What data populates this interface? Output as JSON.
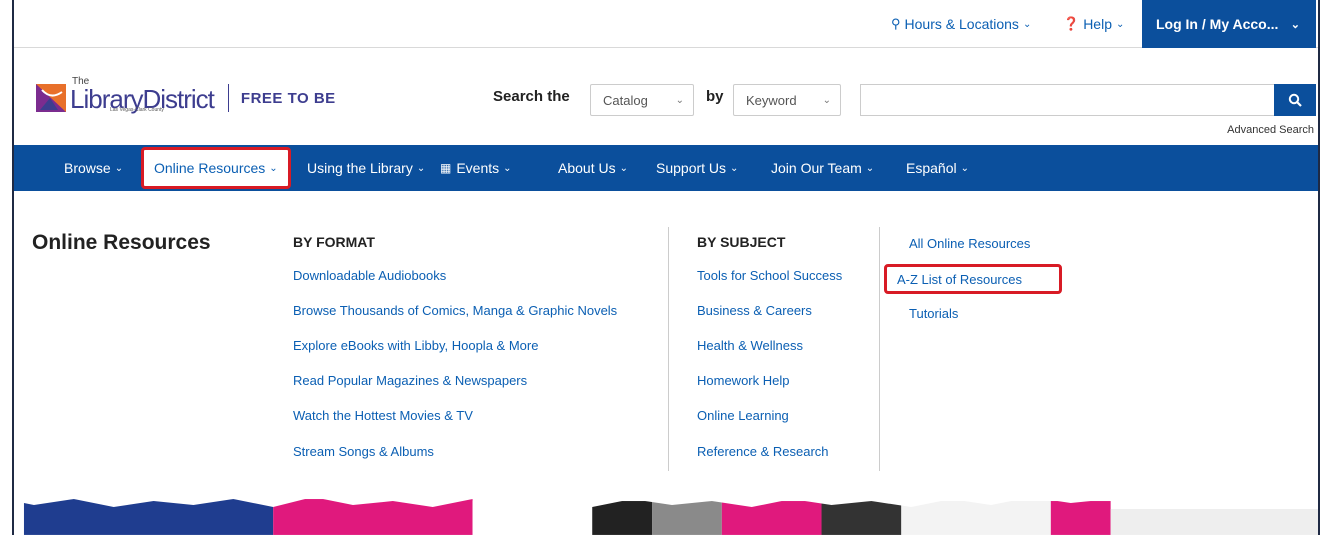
{
  "utility": {
    "hours_label": "Hours & Locations",
    "help_label": "Help",
    "login_label": "Log In / My Acco..."
  },
  "logo": {
    "the": "The",
    "name": "LibraryDistrict",
    "subtitle": "Las Vegas-Clark County",
    "tagline": "FREE TO BE"
  },
  "search": {
    "label": "Search the",
    "scope_selected": "Catalog",
    "by_label": "by",
    "field_selected": "Keyword",
    "query_value": "",
    "advanced_label": "Advanced Search"
  },
  "nav": {
    "items": [
      {
        "label": "Browse"
      },
      {
        "label": "Online Resources"
      },
      {
        "label": "Using the Library"
      },
      {
        "label": "Events"
      },
      {
        "label": "About Us"
      },
      {
        "label": "Support Us"
      },
      {
        "label": "Join Our Team"
      },
      {
        "label": "Español"
      }
    ]
  },
  "mega": {
    "title": "Online Resources",
    "by_format": {
      "heading": "BY FORMAT",
      "links": [
        "Downloadable Audiobooks",
        "Browse Thousands of Comics, Manga & Graphic Novels",
        "Explore eBooks with Libby, Hoopla & More",
        "Read Popular Magazines & Newspapers",
        "Watch the Hottest Movies & TV",
        "Stream Songs & Albums"
      ]
    },
    "by_subject": {
      "heading": "BY SUBJECT",
      "links": [
        "Tools for School Success",
        "Business & Careers",
        "Health & Wellness",
        "Homework Help",
        "Online Learning",
        "Reference & Research"
      ]
    },
    "quick": {
      "links": [
        "All Online Resources",
        "A-Z List of Resources",
        "Tutorials"
      ]
    }
  },
  "colors": {
    "brand_blue": "#0b4f9c",
    "link_blue": "#0b5fb3",
    "highlight_red": "#d81b25",
    "logo_purple": "#3d3d8f"
  }
}
